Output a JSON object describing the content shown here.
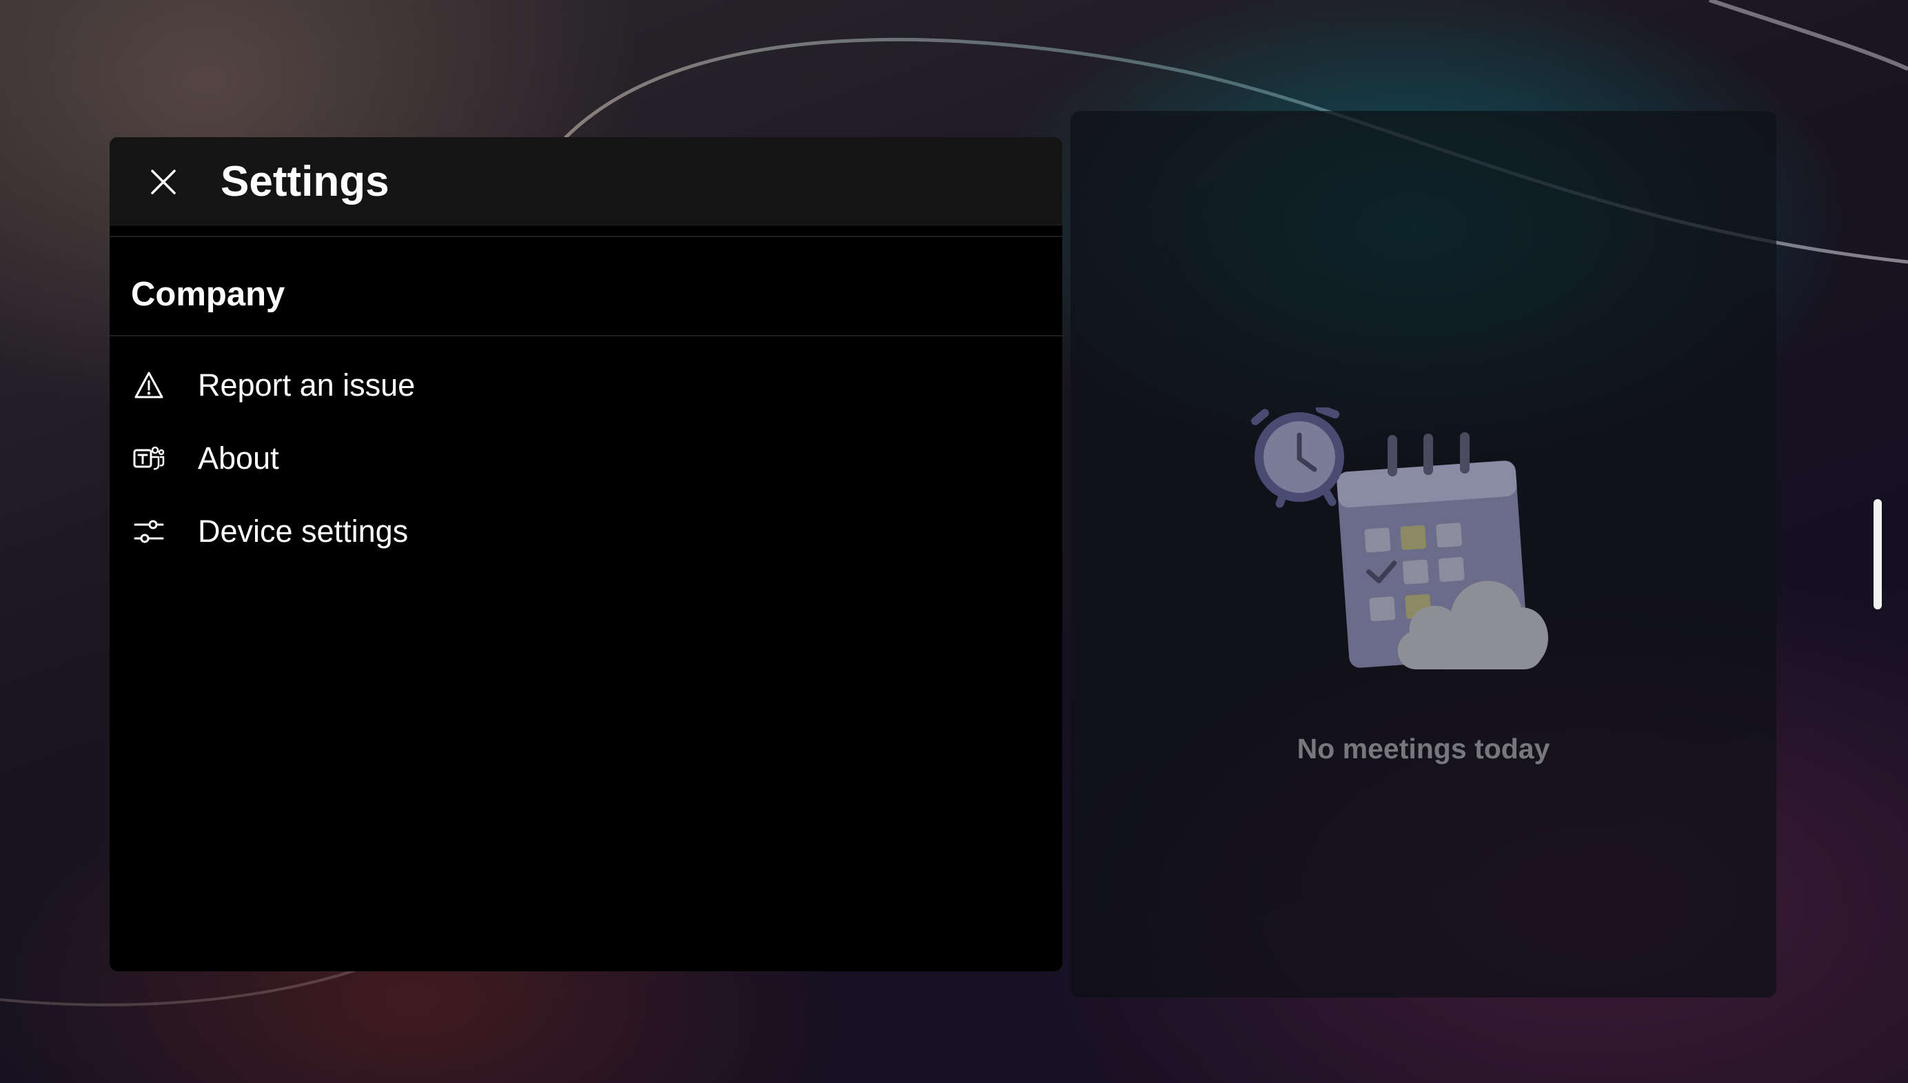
{
  "settings": {
    "title": "Settings",
    "close_icon": "close-icon",
    "section_title": "Company",
    "items": [
      {
        "label": "Report an issue",
        "icon": "warning-icon"
      },
      {
        "label": "About",
        "icon": "teams-icon"
      },
      {
        "label": "Device settings",
        "icon": "sliders-icon"
      }
    ]
  },
  "meetings": {
    "empty_text": "No meetings today",
    "illustration_icon": "calendar-clock-cloud-illustration"
  },
  "colors": {
    "panel_bg": "#000000",
    "header_bg": "#141414",
    "text_primary": "#ffffff",
    "text_muted": "#77787c"
  }
}
